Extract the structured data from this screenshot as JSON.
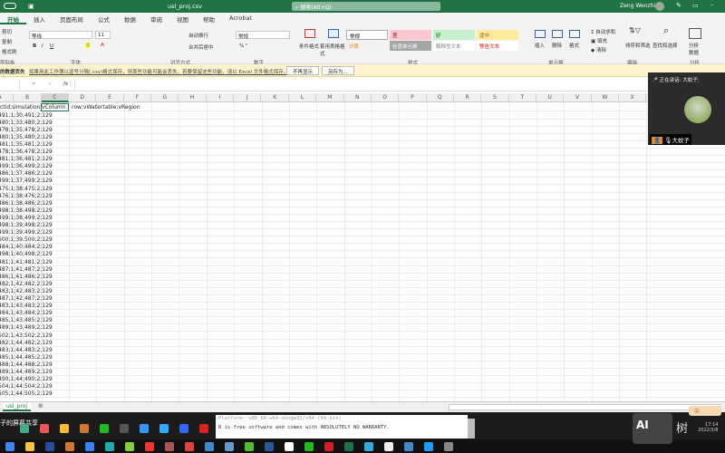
{
  "titlebar": {
    "filename": "usl_proj.csv",
    "search": "搜索(Alt+Q)",
    "user": "Zeng Wenzhi"
  },
  "tabs": [
    "开始",
    "插入",
    "页面布局",
    "公式",
    "数据",
    "审阅",
    "视图",
    "帮助",
    "Acrobat"
  ],
  "ribbon": {
    "clipboard": [
      "剪切",
      "复制",
      "格式刷"
    ],
    "clipboard_label": "剪贴板",
    "font_name": "等线",
    "font_size": "11",
    "font_label": "字体",
    "wrap": "自动换行",
    "merge": "合并后居中",
    "align_label": "对齐方式",
    "number_format": "常规",
    "number_label": "数字",
    "cond_format": "条件格式",
    "table_format": "套用表格格式",
    "styles": [
      {
        "label": "常规",
        "bg": "#ffffff",
        "color": "#000"
      },
      {
        "label": "差",
        "bg": "#ffc7ce",
        "color": "#9c0006"
      },
      {
        "label": "好",
        "bg": "#c6efce",
        "color": "#006100"
      },
      {
        "label": "适中",
        "bg": "#ffeb9c",
        "color": "#9c5700"
      },
      {
        "label": "计算",
        "bg": "#f2f2f2",
        "color": "#fa7d00"
      },
      {
        "label": "检查单元格",
        "bg": "#a5a5a5",
        "color": "#fff"
      },
      {
        "label": "解释性文本",
        "bg": "#ffffff",
        "color": "#7f7f7f"
      },
      {
        "label": "警告文本",
        "bg": "#ffffff",
        "color": "#ff0000"
      }
    ],
    "styles_label": "样式",
    "cells": [
      "插入",
      "删除",
      "格式"
    ],
    "cells_label": "单元格",
    "editing": [
      "自动求和",
      "填充",
      "清除"
    ],
    "sort": "排序和筛选",
    "find": "查找和选择",
    "editing_label": "编辑",
    "analyze": "分析数据",
    "analyze_label": "分析",
    "comment": "批注"
  },
  "msgbar": {
    "title": "的数据丢失",
    "text": "如果用此工作簿以逗号分隔(.csv)格式保存，则某些功能可能会丢失。若要保留这些功能，请以 Excel 文件格式保存。",
    "dont_show": "不再显示",
    "save_as": "另存为..."
  },
  "formula_bar": {
    "fx": "fx",
    "value": ""
  },
  "columns": [
    "A",
    "B",
    "C",
    "D",
    "E",
    "F",
    "G",
    "H",
    "I",
    "J",
    "K",
    "L",
    "M",
    "N",
    "O",
    "P",
    "Q",
    "R",
    "S",
    "T",
    "U",
    "V",
    "W",
    "X"
  ],
  "header_row": {
    "a": "ctid;simulationid",
    "c": "vColumn",
    "d": "row;vWatertable;vRegion"
  },
  "rows": [
    "491;1;30;491;2;129",
    "480;1;33;480;2;129",
    "478;1;35;478;2;129",
    "480;1;35;480;2;129",
    "481;1;35;481;2;129",
    "478;1;36;478;2;129",
    "481;1;36;481;2;129",
    "499;1;36;499;2;129",
    "486;1;37;486;2;129",
    "499;1;37;499;2;129",
    "475;1;38;475;2;129",
    "476;1;38;476;2;129",
    "486;1;38;486;2;129",
    "498;1;38;498;2;129",
    "499;1;38;499;2;129",
    "498;1;39;498;2;129",
    "499;1;39;499;2;129",
    "500;1;39;500;2;129",
    "484;1;40;484;2;129",
    "498;1;40;498;2;129",
    "481;1;41;481;2;129",
    "487;1;41;487;2;129",
    "486;1;41;486;2;129",
    "482;1;42;482;2;129",
    "483;1;42;483;2;129",
    "487;1;42;487;2;129",
    "483;1;43;483;2;129",
    "484;1;43;484;2;129",
    "485;1;43;485;2;129",
    "489;1;43;489;2;129",
    "502;1;43;502;2;129",
    "482;1;44;482;2;129",
    "483;1;44;483;2;129",
    "485;1;44;485;2;129",
    "488;1;44;488;2;129",
    "489;1;44;489;2;129",
    "490;1;44;490;2;129",
    "504;1;44;504;2;129",
    "505;1;44;505;2;129"
  ],
  "sheet_tab": "usl_proj",
  "screen_share": "子的屏幕共享",
  "terminal": [
    "Platform: x86_64-w64-mingw32/x64 (64-bit)",
    "R is free software and comes with ABSOLUTELY NO WARRANTY."
  ],
  "video": {
    "speaking": "正在讲话: 大蚊子;",
    "name": "大蚊子"
  },
  "ime": "中",
  "watermark": "AI 树叶",
  "clock": {
    "time": "17:14",
    "date": "2022/3/8"
  },
  "taskbar_colors": [
    "#4a8",
    "#e55",
    "#fb3",
    "#c73",
    "#2b2",
    "#555",
    "#39f",
    "#3af",
    "#36f",
    "#d22",
    "#c33"
  ],
  "taskbar2_colors": [
    "#4285f4",
    "#f5c342",
    "#2a4d9b",
    "#c73",
    "#3b82f6",
    "#2aa",
    "#8c4",
    "#e33",
    "#a55",
    "#d44",
    "#48c",
    "#69c",
    "#5b3",
    "#2b5797",
    "#fff",
    "#2b2",
    "#c22",
    "#1e7145",
    "#3ad",
    "#eee",
    "#48c",
    "#29f",
    "#888"
  ]
}
